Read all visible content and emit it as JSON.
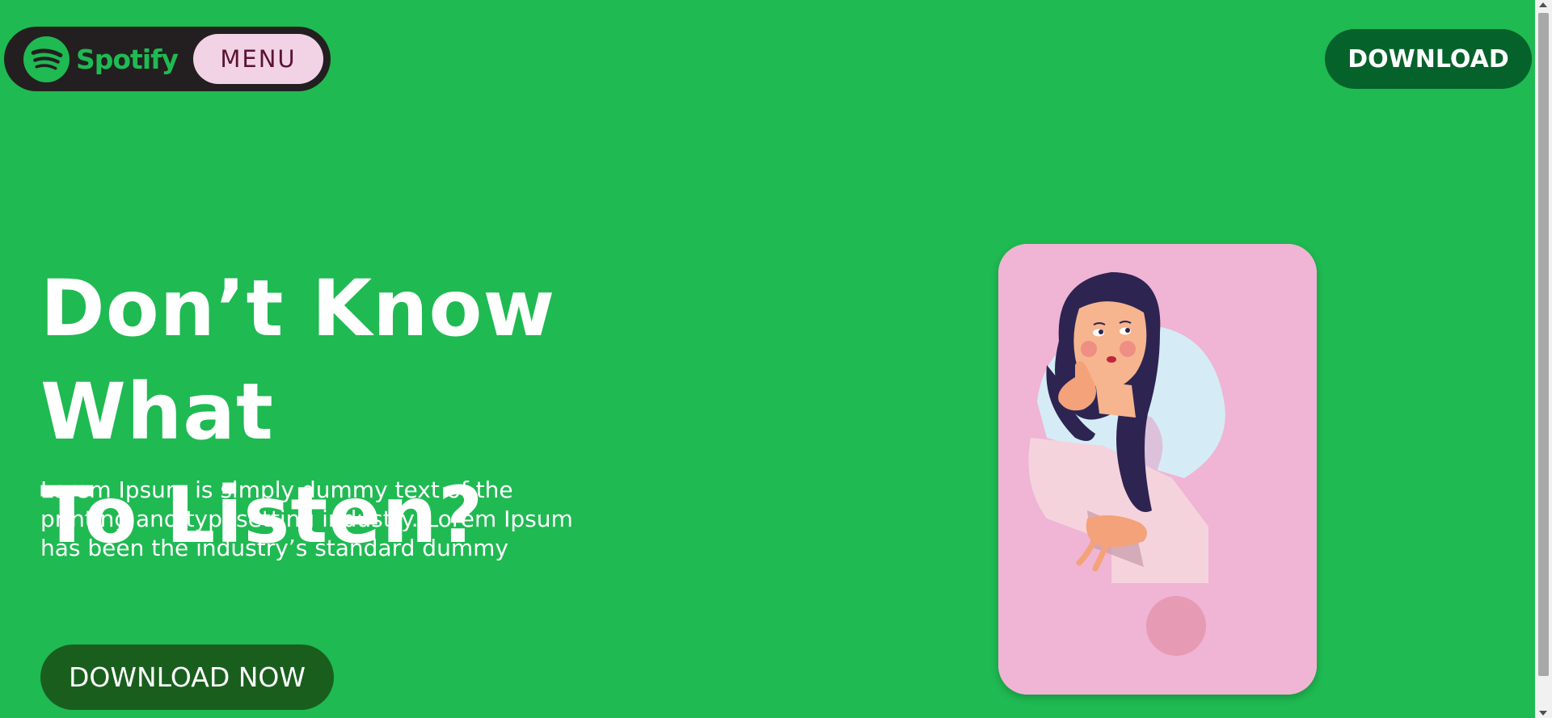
{
  "colors": {
    "background": "#1fba52",
    "nav_pill": "#231f20",
    "menu_button": "#f2d3e6",
    "download_button": "#05622a",
    "download_now_button": "#1a5e1e",
    "card": "#f0b4d4"
  },
  "header": {
    "logo_text": "Spotify",
    "logo_icon": "spotify-icon",
    "menu_label": "MENU",
    "download_label": "DOWNLOAD"
  },
  "hero": {
    "title_line1": "Don’t Know What",
    "title_line2": "To Listen?",
    "description_line1": "Lorem Ipsum is simply dummy text of the",
    "description_line2": "printing and typesetting industry. Lorem Ipsum",
    "description_line3": "has been the industry’s standard dummy",
    "cta_label": "DOWNLOAD NOW"
  },
  "illustration": {
    "subject": "thinking-woman-question-mark-icon"
  }
}
